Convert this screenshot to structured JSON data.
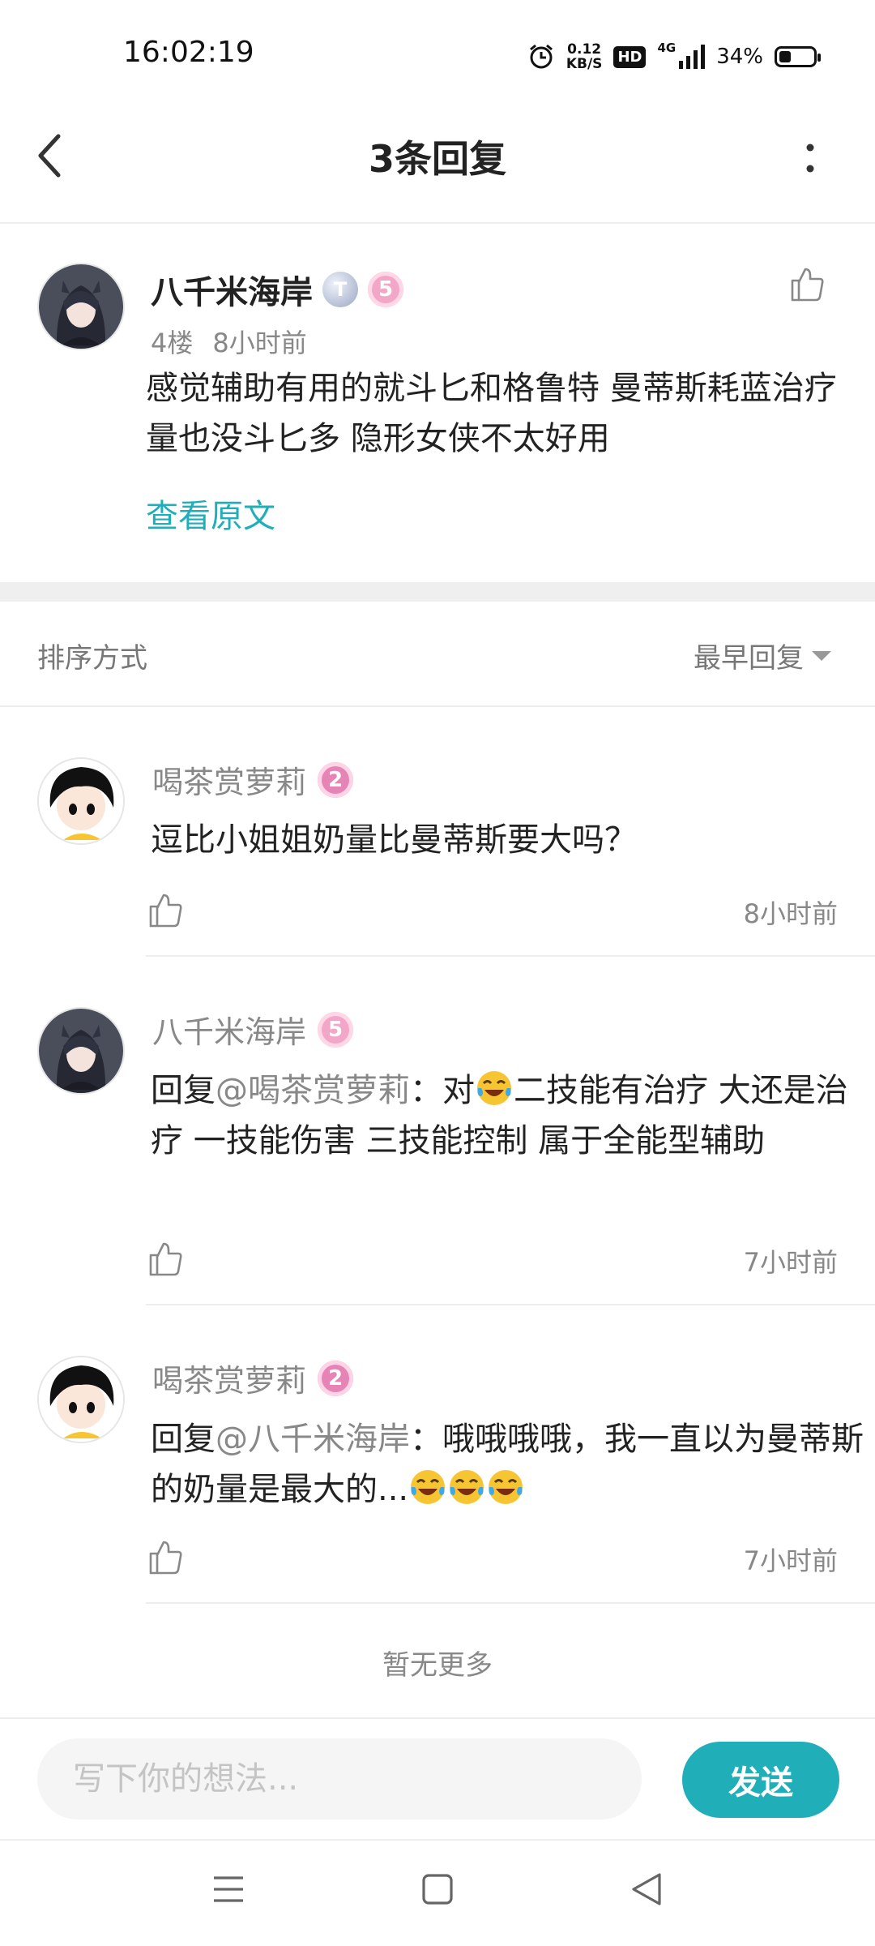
{
  "status_bar": {
    "time": "16:02:19",
    "net_speed_value": "0.12",
    "net_speed_unit": "KB/S",
    "hd": "HD",
    "network": "4G",
    "battery_text": "34%",
    "battery_level": 0.34
  },
  "header": {
    "title": "3条回复"
  },
  "post": {
    "author": "八千米海岸",
    "floor": "4楼",
    "time": "8小时前",
    "content": "感觉辅助有用的就斗匕和格鲁特 曼蒂斯耗蓝治疗量也没斗匕多 隐形女侠不太好用",
    "view_original": "查看原文",
    "badge_t": "T",
    "level": "5"
  },
  "sort": {
    "label": "排序方式",
    "selected": "最早回复"
  },
  "replies": [
    {
      "author": "喝茶赏萝莉",
      "level": "2",
      "mention": "",
      "text": "逗比小姐姐奶量比曼蒂斯要大吗？",
      "time": "8小时前"
    },
    {
      "author": "八千米海岸",
      "level": "5",
      "prefix": "回复",
      "mention": "@喝茶赏萝莉",
      "text_before_emoji": "：对",
      "text_after_emoji": "二技能有治疗 大还是治疗 一技能伤害 三技能控制 属于全能型辅助",
      "time": "7小时前"
    },
    {
      "author": "喝茶赏萝莉",
      "level": "2",
      "prefix": "回复",
      "mention": "@八千米海岸",
      "text": "：哦哦哦哦，我一直以为曼蒂斯的奶量是最大的...",
      "time": "7小时前"
    }
  ],
  "no_more": "暂无更多",
  "input": {
    "placeholder": "写下你的想法...",
    "send_label": "发送"
  },
  "colors": {
    "accent": "#20aeb8",
    "secondary_text": "#888888"
  },
  "icons": [
    "back-arrow-icon",
    "more-vertical-icon",
    "thumb-up-icon",
    "alarm-icon",
    "signal-icon",
    "battery-icon",
    "menu-icon",
    "home-square-icon",
    "back-triangle-icon"
  ]
}
